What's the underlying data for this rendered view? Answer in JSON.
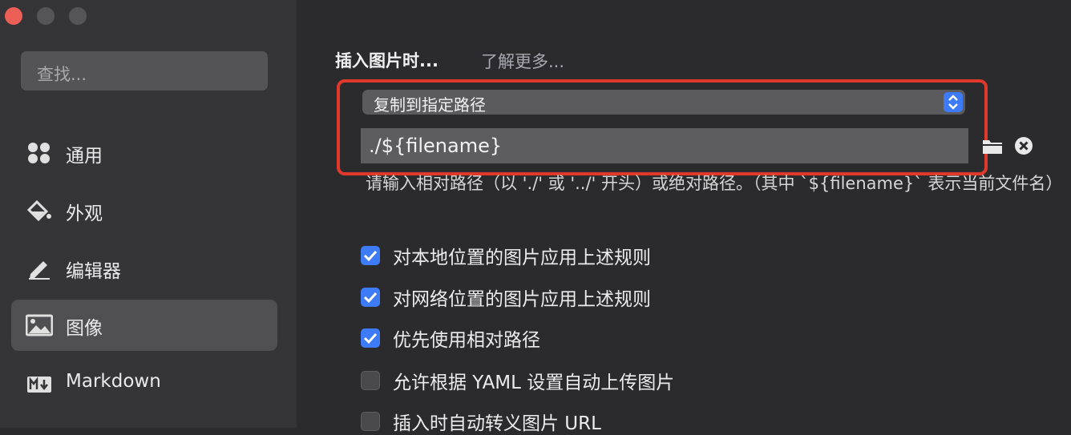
{
  "sidebar": {
    "search_placeholder": "查找...",
    "items": [
      {
        "label": "通用",
        "icon": "grid-icon"
      },
      {
        "label": "外观",
        "icon": "paint-bucket-icon"
      },
      {
        "label": "编辑器",
        "icon": "pencil-icon"
      },
      {
        "label": "图像",
        "icon": "image-icon",
        "active": true
      },
      {
        "label": "Markdown",
        "icon": "markdown-icon"
      }
    ]
  },
  "image_settings": {
    "title": "插入图片时...",
    "learn_more": "了解更多...",
    "select_value": "复制到指定路径",
    "path_value": "./${filename}",
    "hint_text": "请输入相对路径（以 './' 或 '../' 开头）或绝对路径。（其中 `${filename}` 表示当前文件名）",
    "options": [
      {
        "label": "对本地位置的图片应用上述规则",
        "checked": true
      },
      {
        "label": "对网络位置的图片应用上述规则",
        "checked": true
      },
      {
        "label": "优先使用相对路径",
        "checked": true
      },
      {
        "label": "允许根据 YAML 设置自动上传图片",
        "checked": false
      },
      {
        "label": "插入时自动转义图片 URL",
        "checked": false
      }
    ]
  },
  "colors": {
    "accent": "#3e7bf6",
    "highlight_border": "#e0382b",
    "close_button": "#ec5f57"
  }
}
